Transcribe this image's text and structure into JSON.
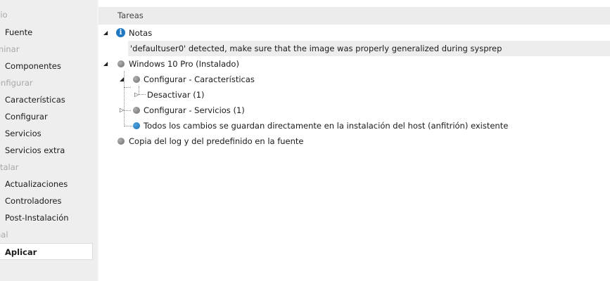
{
  "sidebar": {
    "sections": [
      {
        "heading": "cio",
        "items": [
          {
            "label": "Fuente"
          }
        ]
      },
      {
        "heading": "minar",
        "items": [
          {
            "label": "Componentes"
          }
        ]
      },
      {
        "heading": "onfigurar",
        "items": [
          {
            "label": "Características"
          },
          {
            "label": "Configurar"
          },
          {
            "label": "Servicios"
          },
          {
            "label": "Servicios extra"
          }
        ]
      },
      {
        "heading": "stalar",
        "items": [
          {
            "label": "Actualizaciones"
          },
          {
            "label": "Controladores"
          },
          {
            "label": "Post-Instalación"
          }
        ]
      },
      {
        "heading": "nal",
        "items": [
          {
            "label": "Aplicar",
            "active": true
          }
        ]
      }
    ]
  },
  "tasks": {
    "header": "Tareas",
    "notes_label": "Notas",
    "notes_message": "'defaultuser0' detected, make sure that the image was properly generalized during sysprep",
    "windows_label": "Windows 10 Pro  (Instalado)",
    "config_features_label": "Configurar - Características",
    "disable_label": "Desactivar (1)",
    "config_services_label": "Configurar - Servicios (1)",
    "changes_label": "Todos los cambios se guardan directamente en la instalación del host (anfitrión) existente",
    "copy_log_label": "Copia del log y del predefinido en la fuente"
  },
  "colors": {
    "sidebar_bg": "#eeeeee",
    "header_bg": "#ececec",
    "info_blue": "#1f78c1",
    "bullet_grey": "#8a8a8a",
    "bullet_blue": "#2a80c8"
  }
}
